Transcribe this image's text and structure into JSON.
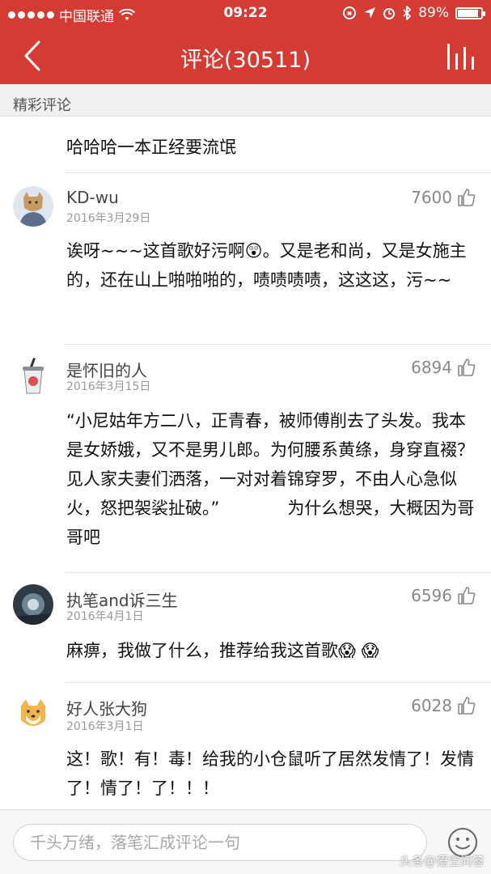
{
  "status_bar": {
    "carrier": "中国联通",
    "time": "09:22",
    "battery_percent": "89%",
    "battery_level": 0.89
  },
  "nav": {
    "title": "评论(30511)"
  },
  "section": {
    "title": "精彩评论"
  },
  "comments": [
    {
      "text": "哈哈哈一本正经要流氓"
    },
    {
      "username": "KD-wu",
      "date": "2016年3月29日",
      "likes": "7600",
      "text": "诶呀~~~这首歌好污啊😲。又是老和尚，又是女施主的，还在山上啪啪啪的，啧啧啧啧，这这这，污~~"
    },
    {
      "username": "是怀旧的人",
      "date": "2016年3月15日",
      "likes": "6894",
      "text": "“小尼姑年方二八，正青春，被师傅削去了头发。我本是女娇娥，又不是男儿郎。为何腰系黄绦，身穿直裰？见人家夫妻们洒落，一对对着锦穿罗，不由人心急似火，怒把袈裟扯破。”　　　　为什么想哭，大概因为哥哥吧"
    },
    {
      "username": "执笔and诉三生",
      "date": "2016年4月1日",
      "likes": "6596",
      "text": "麻痹，我做了什么，推荐给我这首歌😱 😱"
    },
    {
      "username": "好人张大狗",
      "date": "2016年3月1日",
      "likes": "6028",
      "text": "这！歌！有！毒！给我的小仓鼠听了居然发情了！发情了！情了！了！！！"
    }
  ],
  "input": {
    "placeholder": "千头万绪，落笔汇成评论一句"
  },
  "watermark": "头条@悟空问答",
  "colors": {
    "brand_red": "#d43c33"
  },
  "icons": [
    "wifi-icon",
    "back-icon",
    "stats-icon",
    "thumb-up-icon",
    "smile-icon"
  ]
}
